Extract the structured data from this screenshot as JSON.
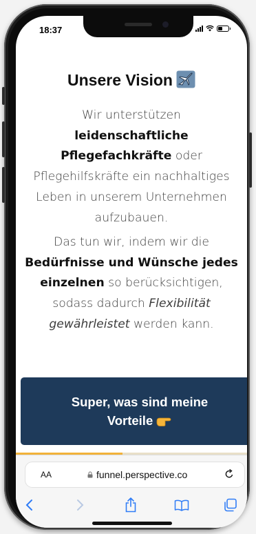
{
  "status_bar": {
    "time": "18:37"
  },
  "page": {
    "title": "Unsere Vision",
    "title_icon": "airplane-icon",
    "paragraph1": {
      "t1": "Wir unterstützen ",
      "b1": "leidenschaftliche Pflegefachkräfte",
      "t2": " oder Pflegehilfskräfte ein nachhaltiges Leben in unserem Unternehmen aufzubauen."
    },
    "paragraph2": {
      "t1": "Das tun wir, indem wir die ",
      "b1": "Bedürfnisse und Wünsche jedes einzelnen",
      "t2": " so berücksichtigen, sodass dadurch ",
      "i1": "Flexibilität gewährleistet",
      "t3": " werden kann."
    }
  },
  "cta": {
    "line1": "Super, was sind meine",
    "line2": "Vorteile",
    "icon": "pointing-hand-icon"
  },
  "progress": {
    "fraction": 0.46
  },
  "browser": {
    "aa_label": "AA",
    "url": "funnel.perspective.co"
  },
  "colors": {
    "cta_bg": "#1e3a5a",
    "progress_fill": "#f2b23a",
    "ios_blue": "#2f7cf6"
  }
}
